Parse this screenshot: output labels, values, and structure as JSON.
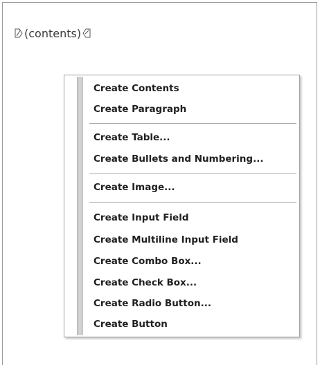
{
  "document": {
    "tag_open_icon": "tag-open-marker",
    "tag_text": "(contents)",
    "tag_close_icon": "tag-close-marker"
  },
  "context_menu": {
    "groups": [
      {
        "items": [
          {
            "label": "Create Contents"
          },
          {
            "label": "Create Paragraph"
          }
        ]
      },
      {
        "items": [
          {
            "label": "Create Table..."
          },
          {
            "label": "Create Bullets and Numbering..."
          }
        ]
      },
      {
        "items": [
          {
            "label": "Create Image..."
          }
        ]
      },
      {
        "items": [
          {
            "label": "Create Input Field"
          },
          {
            "label": "Create Multiline Input Field"
          },
          {
            "label": "Create Combo Box..."
          },
          {
            "label": "Create Check Box..."
          },
          {
            "label": "Create Radio Button..."
          },
          {
            "label": "Create Button"
          }
        ]
      }
    ]
  }
}
